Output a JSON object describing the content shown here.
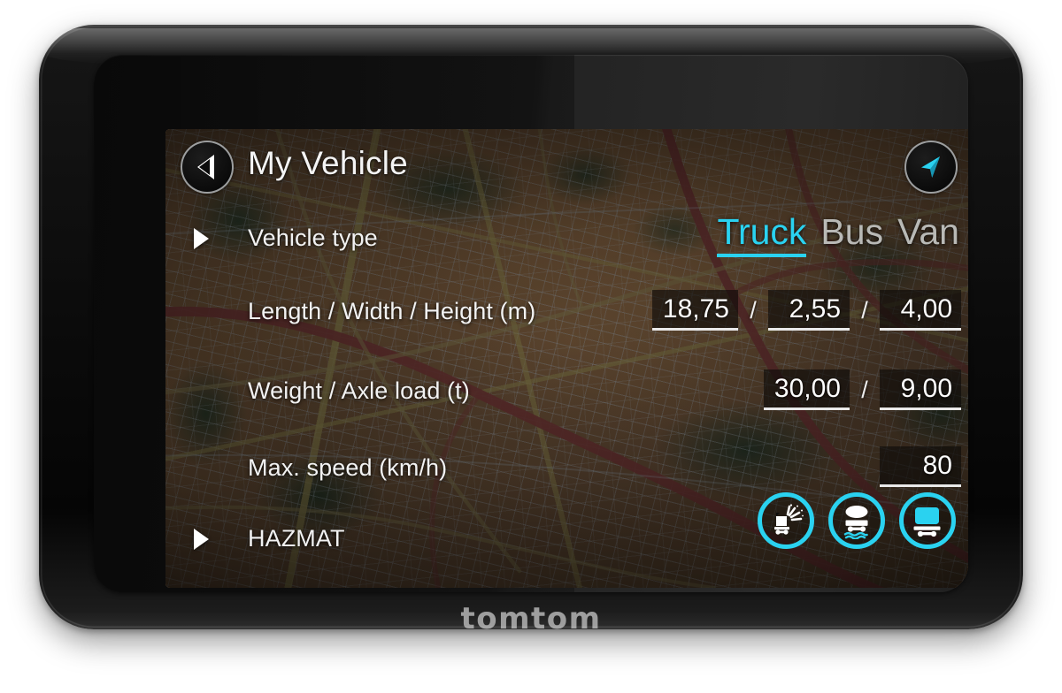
{
  "device": {
    "brand": "TomTom",
    "brand_wordmark": "TomTom"
  },
  "screen": {
    "header": {
      "title": "My Vehicle",
      "back_icon": "back-arrow-icon",
      "nav_icon": "navigation-arrow-icon"
    },
    "rows": [
      {
        "id": "vehicle-type",
        "label": "Vehicle type",
        "chevron": "chevron-right-icon"
      },
      {
        "id": "dimensions",
        "label": "Length / Width / Height (m)"
      },
      {
        "id": "weights",
        "label": "Weight / Axle load (t)"
      },
      {
        "id": "max-speed",
        "label": "Max. speed (km/h)"
      },
      {
        "id": "hazmat",
        "label": "HAZMAT",
        "chevron": "chevron-right-icon"
      }
    ],
    "vehicle_types": [
      {
        "label": "Truck",
        "selected": true
      },
      {
        "label": "Bus",
        "selected": false
      },
      {
        "label": "Van",
        "selected": false
      }
    ],
    "dimensions": {
      "length": "18,75",
      "separator_1": "/",
      "width": "2,55",
      "separator_2": "/",
      "height": "4,00",
      "unit": "m"
    },
    "weights": {
      "weight": "30,00",
      "separator": "/",
      "axle_load": "9,00",
      "unit": "t"
    },
    "max_speed": {
      "value": "80",
      "unit": "km/h"
    },
    "hazmat_icons": [
      {
        "id": "explosive-goods-icon",
        "name": "explosive-goods",
        "active": false
      },
      {
        "id": "water-polluting-icon",
        "name": "water-polluting-goods",
        "active": false
      },
      {
        "id": "general-hazmat-icon",
        "name": "general-hazardous-goods",
        "active": true
      }
    ],
    "colors": {
      "accent_cyan": "#2AD2F0",
      "text_primary": "#F4F4F4",
      "text_inactive": "#B9B9B6",
      "field_background": "#0C0A08",
      "map_land": "#77583C",
      "map_park": "#2F4231",
      "map_motorway": "#7A3B39"
    }
  }
}
